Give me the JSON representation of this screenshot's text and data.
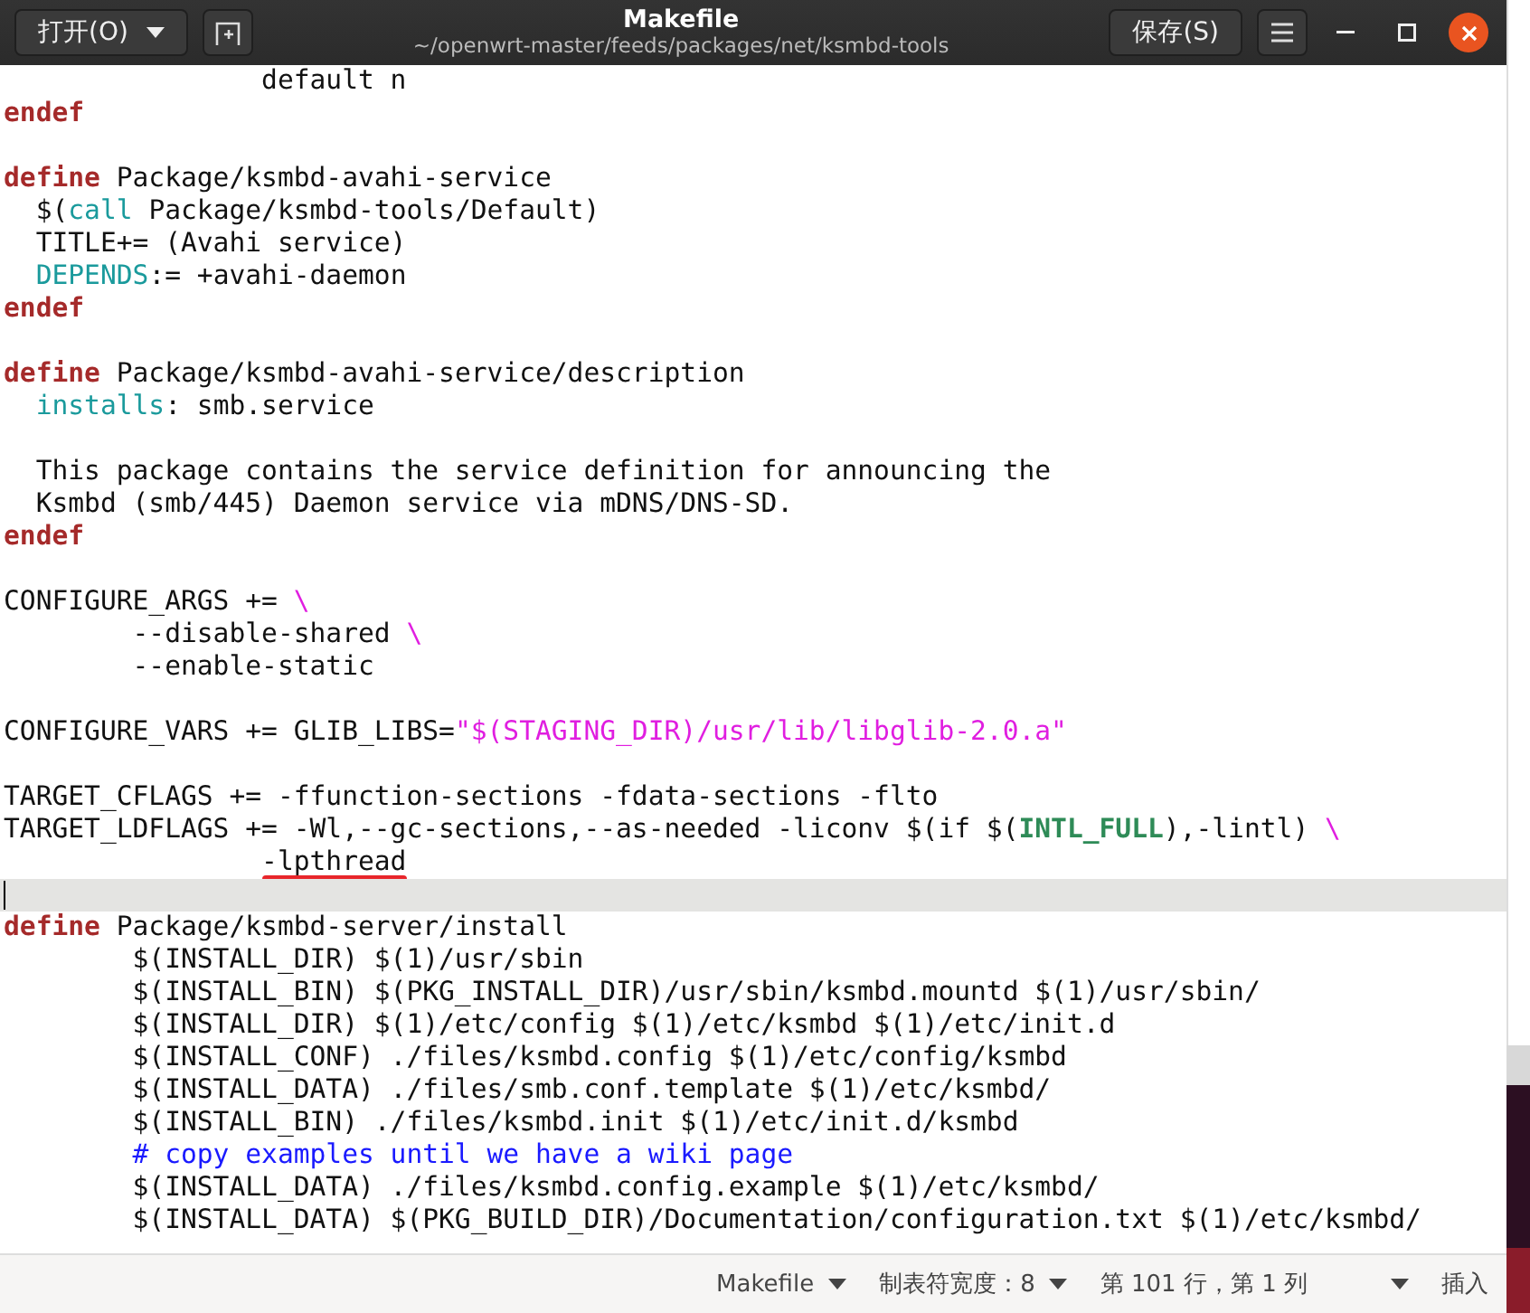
{
  "window": {
    "open_button": "打开(O)",
    "title": "Makefile",
    "subtitle": "~/openwrt-master/feeds/packages/net/ksmbd-tools",
    "save_button": "保存(S)"
  },
  "editor": {
    "lines": [
      {
        "current": false,
        "segments": [
          {
            "text": "                default n",
            "kind": "plain"
          }
        ]
      },
      {
        "current": false,
        "segments": [
          {
            "text": "endef",
            "kind": "keyword"
          }
        ]
      },
      {
        "current": false
      },
      {
        "current": false,
        "segments": [
          {
            "text": "define",
            "kind": "keyword"
          },
          {
            "text": " Package/ksmbd-avahi-service",
            "kind": "plain"
          }
        ]
      },
      {
        "current": false,
        "segments": [
          {
            "text": "  $(",
            "kind": "plain"
          },
          {
            "text": "call",
            "kind": "builtin"
          },
          {
            "text": " Package/ksmbd-tools/Default)",
            "kind": "plain"
          }
        ]
      },
      {
        "current": false,
        "segments": [
          {
            "text": "  TITLE+= (Avahi service)",
            "kind": "plain"
          }
        ]
      },
      {
        "current": false,
        "segments": [
          {
            "text": "  DEPENDS",
            "kind": "builtin"
          },
          {
            "text": ":= +avahi-daemon",
            "kind": "plain"
          }
        ]
      },
      {
        "current": false,
        "segments": [
          {
            "text": "endef",
            "kind": "keyword"
          }
        ]
      },
      {
        "current": false
      },
      {
        "current": false,
        "segments": [
          {
            "text": "define",
            "kind": "keyword"
          },
          {
            "text": " Package/ksmbd-avahi-service/description",
            "kind": "plain"
          }
        ]
      },
      {
        "current": false,
        "segments": [
          {
            "text": "  installs",
            "kind": "builtin"
          },
          {
            "text": ": smb.service",
            "kind": "plain"
          }
        ]
      },
      {
        "current": false
      },
      {
        "current": false,
        "segments": [
          {
            "text": "  This package contains the service definition for announcing the",
            "kind": "plain"
          }
        ]
      },
      {
        "current": false,
        "segments": [
          {
            "text": "  Ksmbd (smb/445) Daemon service via mDNS/DNS-SD.",
            "kind": "plain"
          }
        ]
      },
      {
        "current": false,
        "segments": [
          {
            "text": "endef",
            "kind": "keyword"
          }
        ]
      },
      {
        "current": false
      },
      {
        "current": false,
        "segments": [
          {
            "text": "CONFIGURE_ARGS += ",
            "kind": "plain"
          },
          {
            "text": "\\",
            "kind": "string"
          }
        ]
      },
      {
        "current": false,
        "segments": [
          {
            "text": "        --disable-shared ",
            "kind": "plain"
          },
          {
            "text": "\\",
            "kind": "string"
          }
        ]
      },
      {
        "current": false,
        "segments": [
          {
            "text": "        --enable-static",
            "kind": "plain"
          }
        ]
      },
      {
        "current": false
      },
      {
        "current": false,
        "segments": [
          {
            "text": "CONFIGURE_VARS += GLIB_LIBS=",
            "kind": "plain"
          },
          {
            "text": "\"$(STAGING_DIR)/usr/lib/libglib-2.0.a\"",
            "kind": "string"
          }
        ]
      },
      {
        "current": false
      },
      {
        "current": false,
        "segments": [
          {
            "text": "TARGET_CFLAGS += -ffunction-sections -fdata-sections -flto",
            "kind": "plain"
          }
        ]
      },
      {
        "current": false,
        "segments": [
          {
            "text": "TARGET_LDFLAGS += -Wl,--gc-sections,--as-needed -liconv $(if $(",
            "kind": "plain"
          },
          {
            "text": "INTL_FULL",
            "kind": "variable"
          },
          {
            "text": "),-lintl) ",
            "kind": "plain"
          },
          {
            "text": "\\",
            "kind": "string"
          }
        ]
      },
      {
        "current": false,
        "segments": [
          {
            "text": "                -lpthread",
            "kind": "plain",
            "underlined": true
          }
        ]
      },
      {
        "current": true
      },
      {
        "current": false,
        "segments": [
          {
            "text": "define",
            "kind": "keyword"
          },
          {
            "text": " Package/ksmbd-server/install",
            "kind": "plain"
          }
        ]
      },
      {
        "current": false,
        "segments": [
          {
            "text": "        $(INSTALL_DIR) $(1)/usr/sbin",
            "kind": "plain"
          }
        ]
      },
      {
        "current": false,
        "segments": [
          {
            "text": "        $(INSTALL_BIN) $(PKG_INSTALL_DIR)/usr/sbin/ksmbd.mountd $(1)/usr/sbin/",
            "kind": "plain"
          }
        ]
      },
      {
        "current": false,
        "segments": [
          {
            "text": "        $(INSTALL_DIR) $(1)/etc/config $(1)/etc/ksmbd $(1)/etc/init.d",
            "kind": "plain"
          }
        ]
      },
      {
        "current": false,
        "segments": [
          {
            "text": "        $(INSTALL_CONF) ./files/ksmbd.config $(1)/etc/config/ksmbd",
            "kind": "plain"
          }
        ]
      },
      {
        "current": false,
        "segments": [
          {
            "text": "        $(INSTALL_DATA) ./files/smb.conf.template $(1)/etc/ksmbd/",
            "kind": "plain"
          }
        ]
      },
      {
        "current": false,
        "segments": [
          {
            "text": "        $(INSTALL_BIN) ./files/ksmbd.init $(1)/etc/init.d/ksmbd",
            "kind": "plain"
          }
        ]
      },
      {
        "current": false,
        "segments": [
          {
            "text": "        # copy examples until we have a wiki page",
            "kind": "comment"
          }
        ]
      },
      {
        "current": false,
        "segments": [
          {
            "text": "        $(INSTALL_DATA) ./files/ksmbd.config.example $(1)/etc/ksmbd/",
            "kind": "plain"
          }
        ]
      },
      {
        "current": false,
        "segments": [
          {
            "text": "        $(INSTALL_DATA) $(PKG_BUILD_DIR)/Documentation/configuration.txt $(1)/etc/ksmbd/",
            "kind": "plain"
          }
        ]
      }
    ]
  },
  "status_bar": {
    "language": "Makefile",
    "tab_width": "制表符宽度：8",
    "position": "第 101 行，第 1 列",
    "mode": "插入"
  }
}
